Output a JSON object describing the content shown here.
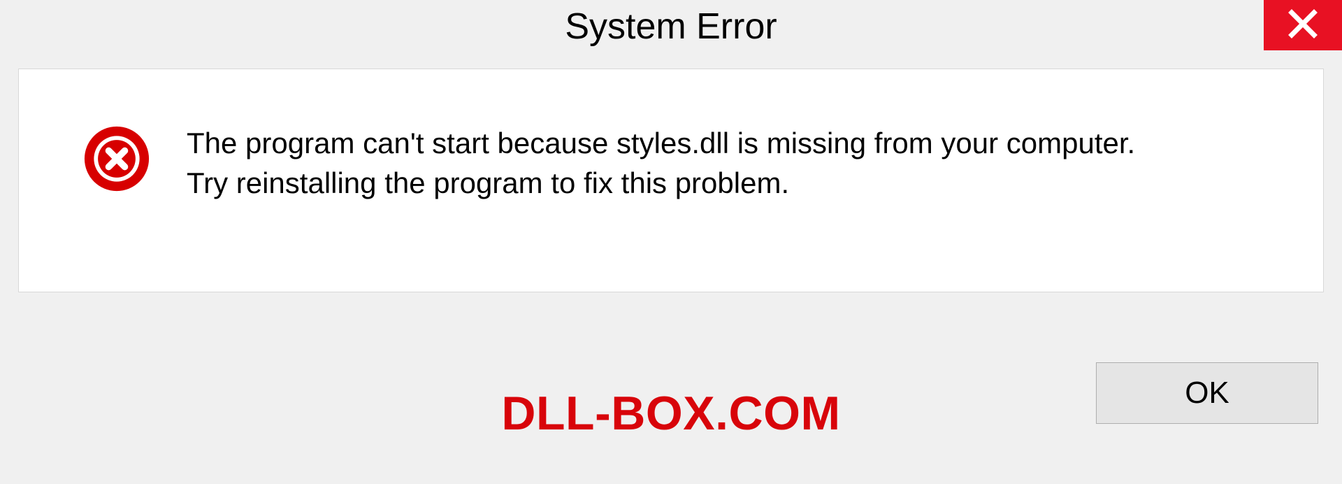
{
  "titlebar": {
    "title": "System Error"
  },
  "message": {
    "line1": "The program can't start because styles.dll is missing from your computer.",
    "line2": "Try reinstalling the program to fix this problem."
  },
  "footer": {
    "brand": "DLL-BOX.COM",
    "ok_label": "OK"
  },
  "colors": {
    "close_bg": "#e81123",
    "error_icon": "#d70000",
    "brand_text": "#d8040a"
  }
}
